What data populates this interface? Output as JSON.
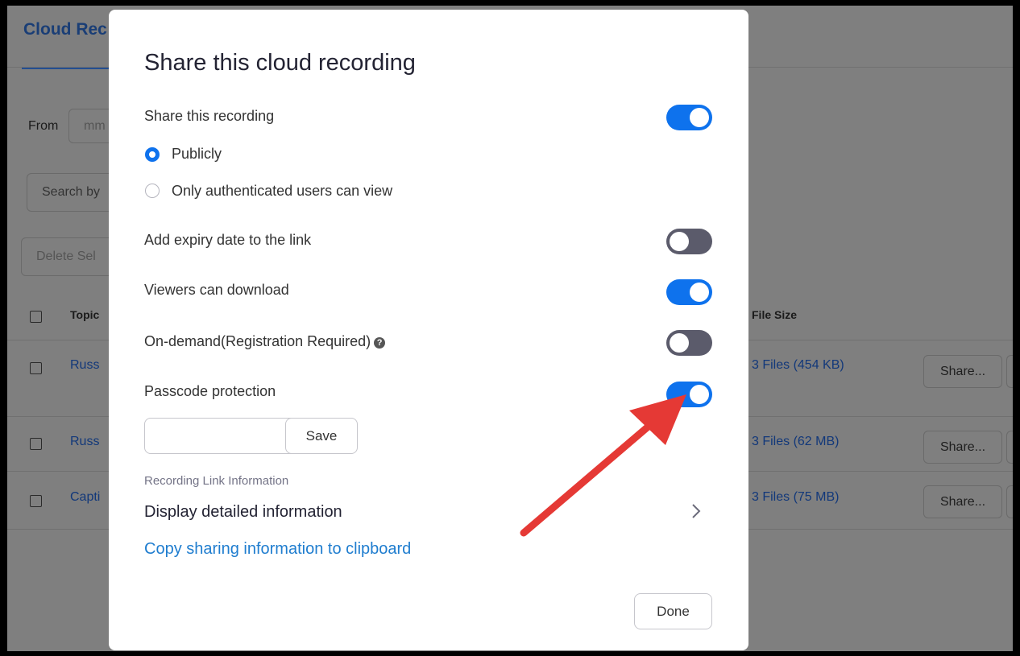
{
  "background": {
    "tab_label": "Cloud Rec",
    "from_label": "From",
    "date_placeholder": "mm",
    "search_placeholder": "Search by",
    "delete_button": "Delete Sel",
    "table": {
      "col_topic": "Topic",
      "col_file_size": "File Size",
      "rows": [
        {
          "topic": "Russ",
          "file_size": "3 Files (454 KB)",
          "share": "Share..."
        },
        {
          "topic": "Russ",
          "file_size": "3 Files (62 MB)",
          "share": "Share..."
        },
        {
          "topic": "Capti",
          "file_size": "3 Files (75 MB)",
          "share": "Share..."
        }
      ]
    }
  },
  "dialog": {
    "title": "Share this cloud recording",
    "share_recording": {
      "label": "Share this recording",
      "enabled": true
    },
    "visibility": {
      "options": [
        {
          "label": "Publicly",
          "selected": true
        },
        {
          "label": "Only authenticated users can view",
          "selected": false
        }
      ]
    },
    "expiry": {
      "label": "Add expiry date to the link",
      "enabled": false
    },
    "download": {
      "label": "Viewers can download",
      "enabled": true
    },
    "on_demand": {
      "label": "On-demand(Registration Required)",
      "enabled": false
    },
    "passcode": {
      "label": "Passcode protection",
      "enabled": true,
      "value": "",
      "save_label": "Save"
    },
    "link_info": {
      "caption": "Recording Link Information",
      "detail_label": "Display detailed information"
    },
    "copy_link": "Copy sharing information to clipboard",
    "done_label": "Done"
  },
  "colors": {
    "toggle_on": "#0e72ed",
    "toggle_off": "#5b5b6b",
    "link": "#1f7dcf",
    "overlay": "#7f7f7f",
    "annotation_arrow": "#e53935"
  }
}
